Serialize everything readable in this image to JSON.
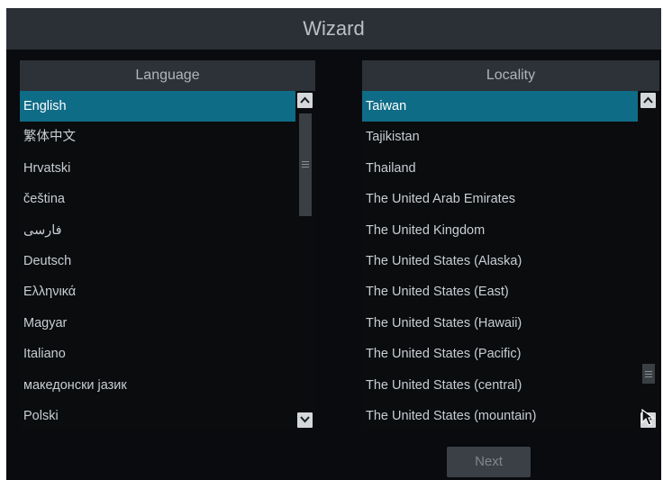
{
  "window": {
    "title": "Wizard"
  },
  "language_panel": {
    "header": "Language",
    "items": [
      "English",
      "繁体中文",
      "Hrvatski",
      "čeština",
      "فارسی",
      "Deutsch",
      "Ελληνικά",
      "Magyar",
      "Italiano",
      "македонски јазик",
      "Polski"
    ],
    "selected_index": 0
  },
  "locality_panel": {
    "header": "Locality",
    "items": [
      "Taiwan",
      "Tajikistan",
      "Thailand",
      "The United Arab Emirates",
      "The United Kingdom",
      "The United States (Alaska)",
      "The United States (East)",
      "The United States (Hawaii)",
      "The United States (Pacific)",
      "The United States (central)",
      "The United States (mountain)"
    ],
    "selected_index": 0
  },
  "footer": {
    "next_label": "Next"
  },
  "icons": {
    "scroll_up": "chevron-up-icon",
    "scroll_down": "chevron-down-icon",
    "cursor": "mouse-pointer-icon"
  },
  "colors": {
    "selected_row": "#0f6c87",
    "titlebar": "#2b3036",
    "header": "#2c3238"
  }
}
